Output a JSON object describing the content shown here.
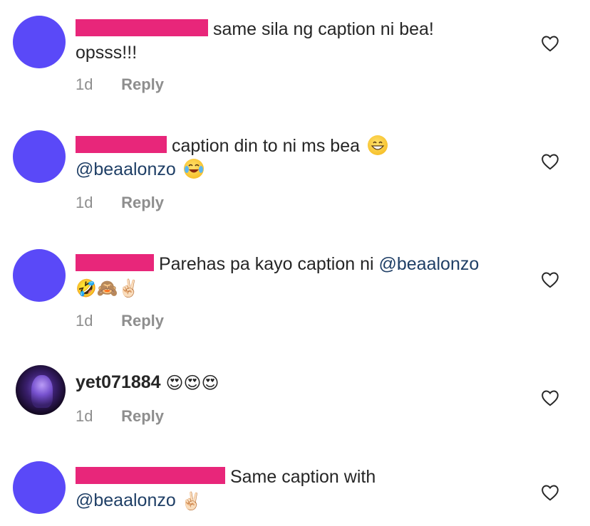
{
  "comments": [
    {
      "line1": "same sila ng caption ni bea!",
      "line2": "opsss!!!",
      "time": "1d",
      "reply": "Reply"
    },
    {
      "line1": "caption din to ni ms bea",
      "mention": "@beaalonzo",
      "time": "1d",
      "reply": "Reply"
    },
    {
      "line1": "Parehas pa kayo caption ni ",
      "mention": "@beaalonzo",
      "emojis": "🤣🙈✌🏻",
      "time": "1d",
      "reply": "Reply"
    },
    {
      "username": "yet071884",
      "emojis": "😍😍😍",
      "time": "1d",
      "reply": "Reply"
    },
    {
      "line1": "Same caption with",
      "mention": "@beaalonzo",
      "emojis": "✌🏻"
    }
  ],
  "icons": {
    "like": "heart-icon",
    "redaction_color": "#e8267a",
    "avatar_color": "#5a49f8"
  }
}
